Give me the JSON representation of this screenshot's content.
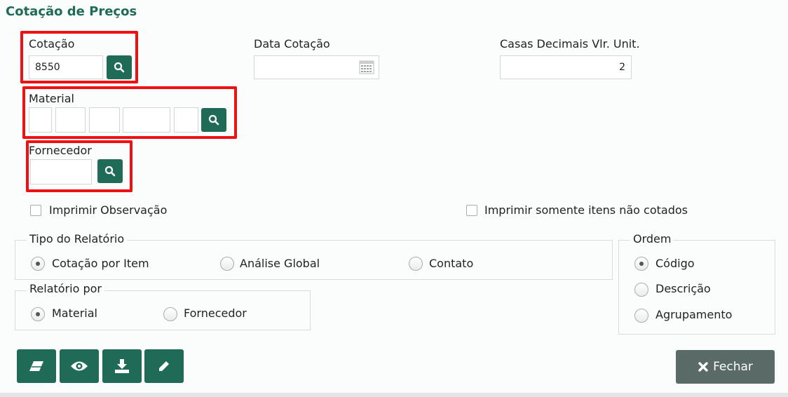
{
  "page_title": "Cotação de Preços",
  "fields": {
    "cotacao": {
      "label": "Cotação",
      "value": "8550"
    },
    "data_cotacao": {
      "label": "Data Cotação",
      "value": ""
    },
    "casas_decimais": {
      "label": "Casas Decimais Vlr. Unit.",
      "value": "2"
    },
    "material": {
      "label": "Material"
    },
    "fornecedor": {
      "label": "Fornecedor"
    }
  },
  "checkboxes": {
    "imprimir_observacao": "Imprimir Observação",
    "imprimir_nao_cotados": "Imprimir somente itens não cotados"
  },
  "tipo_relatorio": {
    "legend": "Tipo do Relatório",
    "options": [
      "Cotação por Item",
      "Análise Global",
      "Contato"
    ],
    "selected": "Cotação por Item"
  },
  "relatorio_por": {
    "legend": "Relatório por",
    "options": [
      "Material",
      "Fornecedor"
    ],
    "selected": "Material"
  },
  "ordem": {
    "legend": "Ordem",
    "options": [
      "Código",
      "Descrição",
      "Agrupamento"
    ],
    "selected": "Código"
  },
  "buttons": {
    "close": "Fechar"
  },
  "colors": {
    "primary": "#1f6b58",
    "highlight": "#ef1111",
    "close_button": "#5a6b67"
  },
  "icons": [
    "search-icon",
    "calendar-icon",
    "eraser-icon",
    "eye-icon",
    "download-icon",
    "pencil-icon",
    "close-icon"
  ]
}
